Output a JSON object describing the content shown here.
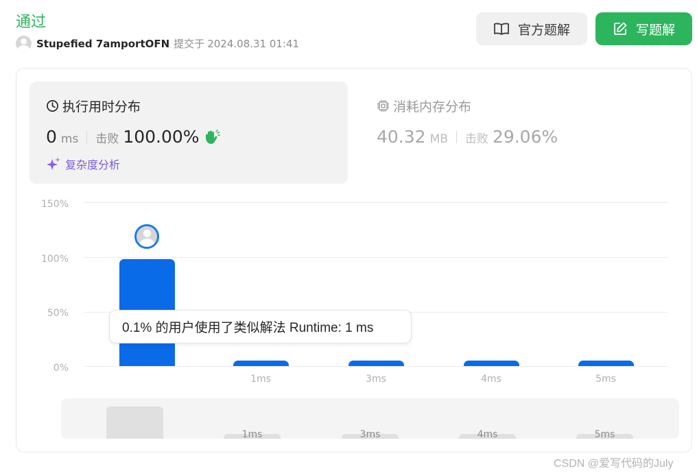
{
  "header": {
    "status": "通过",
    "user_name": "Stupefied 7amportOFN",
    "submit_text": "提交于",
    "submit_time": "2024.08.31 01:41"
  },
  "actions": {
    "official_solution": "官方题解",
    "write_solution": "写题解"
  },
  "runtime": {
    "title": "执行用时分布",
    "value": "0",
    "unit": "ms",
    "beat_label": "击败",
    "beat_pct": "100.00%",
    "complexity_link": "复杂度分析"
  },
  "memory": {
    "title": "消耗内存分布",
    "value": "40.32",
    "unit": "MB",
    "beat_label": "击败",
    "beat_pct": "29.06%"
  },
  "chart": {
    "y_ticks": [
      "150%",
      "100%",
      "50%",
      "0%"
    ],
    "x_ticks": [
      "",
      "1ms",
      "3ms",
      "4ms",
      "5ms"
    ],
    "values": [
      98,
      0.1,
      0.1,
      0.1,
      0.1
    ],
    "tooltip": "0.1% 的用户使用了类似解法 Runtime: 1 ms",
    "bar_color": "#0a6be8"
  },
  "minimap": {
    "labels": [
      "1ms",
      "3ms",
      "4ms",
      "5ms"
    ]
  },
  "watermark": "CSDN @爱写代码的July",
  "colors": {
    "accent": "#2db55d",
    "bar": "#0a6be8",
    "complexity": "#7a5cd6"
  }
}
